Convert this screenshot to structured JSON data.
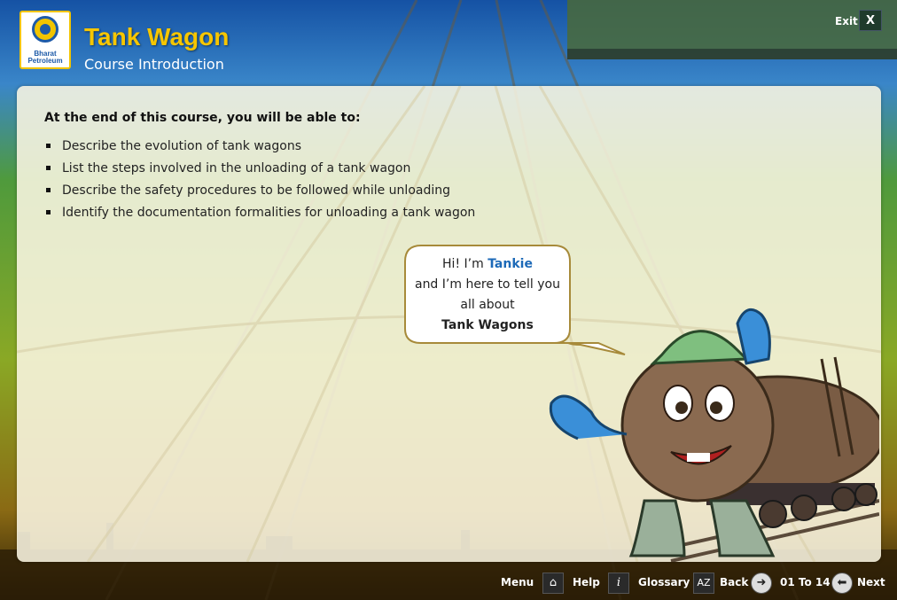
{
  "header": {
    "logo_text_line1": "Bharat",
    "logo_text_line2": "Petroleum",
    "title": "Tank Wagon",
    "subtitle": "Course Introduction",
    "exit_label": "Exit",
    "exit_button": "X"
  },
  "content": {
    "heading": "At the end of this course, you will be able to:",
    "objectives": [
      "Describe the evolution of tank wagons",
      "List the steps involved in the unloading of a tank wagon",
      "Describe the safety procedures to be followed while unloading",
      "Identify the documentation formalities for unloading a tank wagon"
    ]
  },
  "speech_bubble": {
    "greeting": "Hi! I’m ",
    "name": "Tankie",
    "line2": "and I’m here to tell you",
    "line3": "all about",
    "line4": "Tank Wagons"
  },
  "footer": {
    "menu": "Menu",
    "help": "Help",
    "glossary": "Glossary",
    "back": "Back",
    "page_indicator": "01 To 14",
    "next": "Next",
    "glossary_icon_text": "AZ",
    "info_icon_text": "i"
  },
  "icons": {
    "home": "home-icon",
    "info": "info-icon",
    "glossary": "az-icon",
    "back": "back-arrow-icon",
    "next": "next-arrow-icon"
  },
  "colors": {
    "title": "#f7c600",
    "accent_blue": "#1d6ab8"
  }
}
